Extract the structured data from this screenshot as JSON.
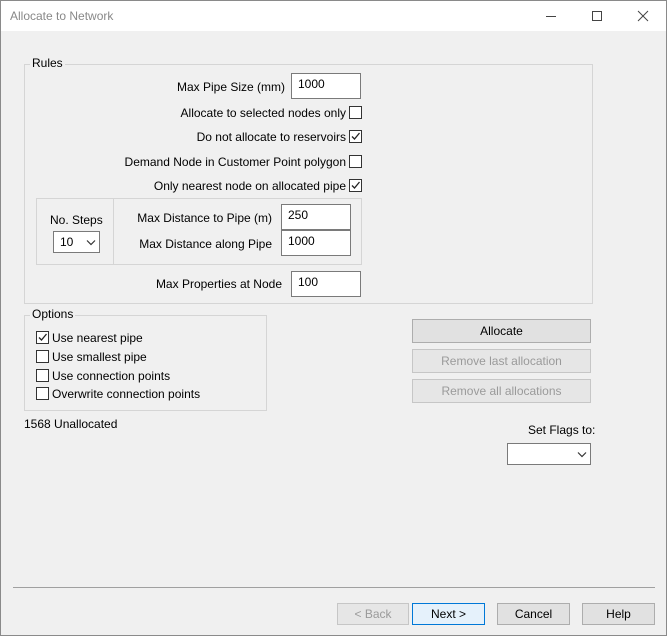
{
  "window": {
    "title": "Allocate to Network"
  },
  "rules": {
    "legend": "Rules",
    "max_pipe_size_label": "Max Pipe Size (mm)",
    "max_pipe_size_value": "1000",
    "allocate_selected_label": "Allocate to selected nodes only",
    "allocate_selected_checked": false,
    "no_reservoirs_label": "Do not allocate to reservoirs",
    "no_reservoirs_checked": true,
    "demand_node_label": "Demand Node in Customer Point polygon",
    "demand_node_checked": false,
    "nearest_node_label": "Only nearest node on allocated pipe",
    "nearest_node_checked": true,
    "no_steps_label": "No. Steps",
    "no_steps_value": "10",
    "max_dist_pipe_label": "Max Distance to Pipe (m)",
    "max_dist_pipe_value": "250",
    "max_dist_along_label": "Max Distance along Pipe",
    "max_dist_along_value": "1000",
    "max_props_label": "Max Properties at Node",
    "max_props_value": "100"
  },
  "options": {
    "legend": "Options",
    "items": [
      {
        "label": "Use nearest pipe",
        "checked": true
      },
      {
        "label": "Use smallest pipe",
        "checked": false
      },
      {
        "label": "Use connection points",
        "checked": false
      },
      {
        "label": "Overwrite connection points",
        "checked": false
      }
    ]
  },
  "actions": {
    "allocate": "Allocate",
    "remove_last": "Remove last allocation",
    "remove_all": "Remove all allocations"
  },
  "status": {
    "unallocated": "1568 Unallocated"
  },
  "flags": {
    "label": "Set Flags to:",
    "value": ""
  },
  "footer": {
    "back": "< Back",
    "next": "Next >",
    "cancel": "Cancel",
    "help": "Help"
  }
}
